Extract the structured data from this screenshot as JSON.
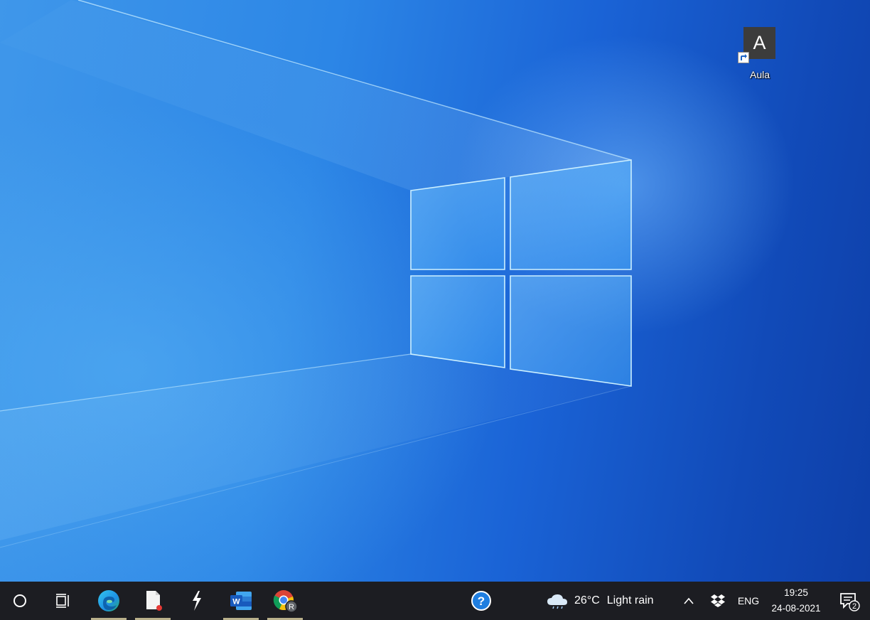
{
  "desktop": {
    "icons": [
      {
        "label": "Aula",
        "tile_letter": "A"
      }
    ]
  },
  "taskbar": {
    "buttons": [
      {
        "name": "search",
        "icon": "cortana-circle-icon"
      },
      {
        "name": "task-view",
        "icon": "task-view-icon"
      },
      {
        "name": "edge",
        "icon": "edge-icon",
        "open": true
      },
      {
        "name": "file",
        "icon": "document-icon",
        "open": true
      },
      {
        "name": "app",
        "icon": "lightning-app-icon",
        "open": false
      },
      {
        "name": "word",
        "icon": "word-icon",
        "open": true,
        "letter": "W"
      },
      {
        "name": "chrome",
        "icon": "chrome-icon",
        "open": true,
        "badge": "R"
      },
      {
        "name": "help",
        "icon": "help-icon",
        "symbol": "?"
      }
    ],
    "weather": {
      "temp": "26°C",
      "condition": "Light rain"
    },
    "tray": {
      "chevron": "^",
      "language": "ENG",
      "time": "19:25",
      "date": "24-08-2021",
      "notification_count": "2"
    }
  },
  "colors": {
    "taskbar_bg": "#1c1d22",
    "underline": "#b9b08b",
    "edge_blue": "#1d8fe3",
    "word_blue": "#185abd"
  }
}
